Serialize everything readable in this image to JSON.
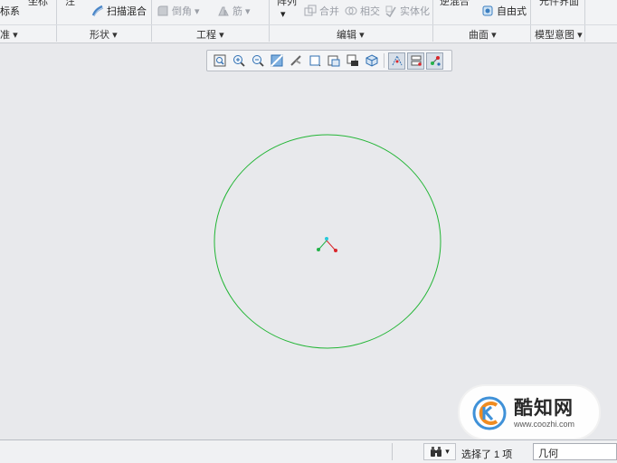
{
  "ribbon": {
    "cut_top": [
      "坐标",
      "注",
      "阵列",
      "逆混合"
    ],
    "items": {
      "coord_system": "标系",
      "sweep_blend": "扫描混合",
      "round": "倒角",
      "rib": "筋",
      "merge": "合并",
      "intersect": "相交",
      "solidify": "实体化",
      "freestyle": "自由式",
      "extra_top": "元件界面"
    },
    "groups": [
      "准",
      "形状",
      "工程",
      "编辑",
      "曲面",
      "模型意图"
    ]
  },
  "view_toolbar": {
    "buttons": [
      "refit",
      "zoom-in",
      "zoom-out",
      "repaint",
      "perspective",
      "display-style",
      "saved-views",
      "view-manager",
      "datum-display",
      "spin-center",
      "annotation-display",
      "csys-display"
    ]
  },
  "status": {
    "selection": "选择了 1 项",
    "filter": "几何"
  },
  "watermark": {
    "name": "酷知网",
    "url": "www.coozhi.com"
  },
  "colors": {
    "circle": "#22b535",
    "csys_x": "#d9262b",
    "csys_y": "#24b24a",
    "csys_z": "#28c8d8"
  }
}
